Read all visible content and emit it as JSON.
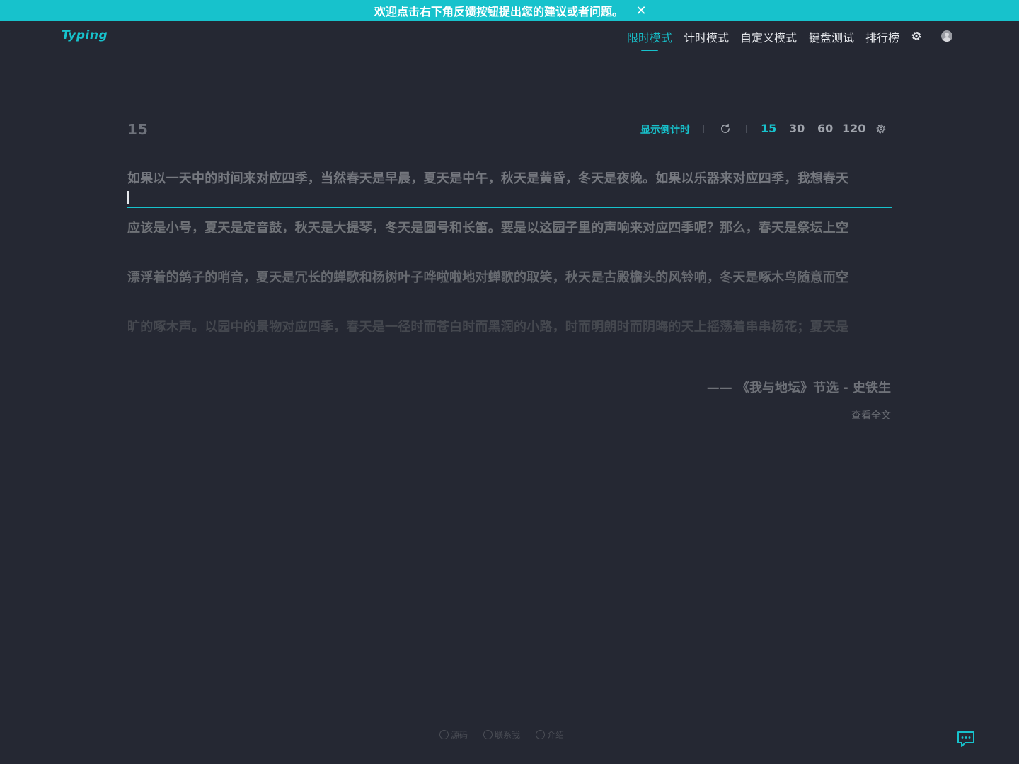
{
  "banner": {
    "text": "欢迎点击右下角反馈按钮提出您的建议或者问题。",
    "close_icon": "✕"
  },
  "header": {
    "logo": "Typing",
    "nav": [
      {
        "label": "限时模式",
        "active": true
      },
      {
        "label": "计时模式",
        "active": false
      },
      {
        "label": "自定义模式",
        "active": false
      },
      {
        "label": "键盘测试",
        "active": false
      },
      {
        "label": "排行榜",
        "active": false
      }
    ],
    "settings_icon": "gear-icon",
    "avatar_icon": "user-avatar"
  },
  "typing": {
    "counter": "15",
    "toolbar": {
      "countdown_label": "显示倒计时",
      "refresh_icon": "refresh-icon",
      "durations": [
        "15",
        "30",
        "60",
        "120"
      ],
      "active_duration": "15",
      "settings_icon": "gear-icon"
    },
    "lines": [
      "如果以一天中的时间来对应四季，当然春天是早晨，夏天是中午，秋天是黄昏，冬天是夜晚。如果以乐器来对应四季，我想春天",
      "应该是小号，夏天是定音鼓，秋天是大提琴，冬天是圆号和长笛。要是以这园子里的声响来对应四季呢？那么，春天是祭坛上空",
      "漂浮着的鸽子的哨音，夏天是冗长的蝉歌和杨树叶子哗啦啦地对蝉歌的取笑，秋天是古殿檐头的风铃响，冬天是啄木鸟随意而空",
      "旷的啄木声。以园中的景物对应四季，春天是一径时而苍白时而黑润的小路，时而明朗时而阴晦的天上摇荡着串串杨花；夏天是"
    ],
    "source": "—— 《我与地坛》节选 - 史铁生",
    "view_full": "查看全文"
  },
  "footer": {
    "links": [
      {
        "label": "源码",
        "icon": "github-icon"
      },
      {
        "label": "联系我",
        "icon": "chat-icon"
      },
      {
        "label": "介绍",
        "icon": "info-icon"
      }
    ]
  },
  "colors": {
    "accent": "#17c2cc",
    "background": "#252833"
  }
}
